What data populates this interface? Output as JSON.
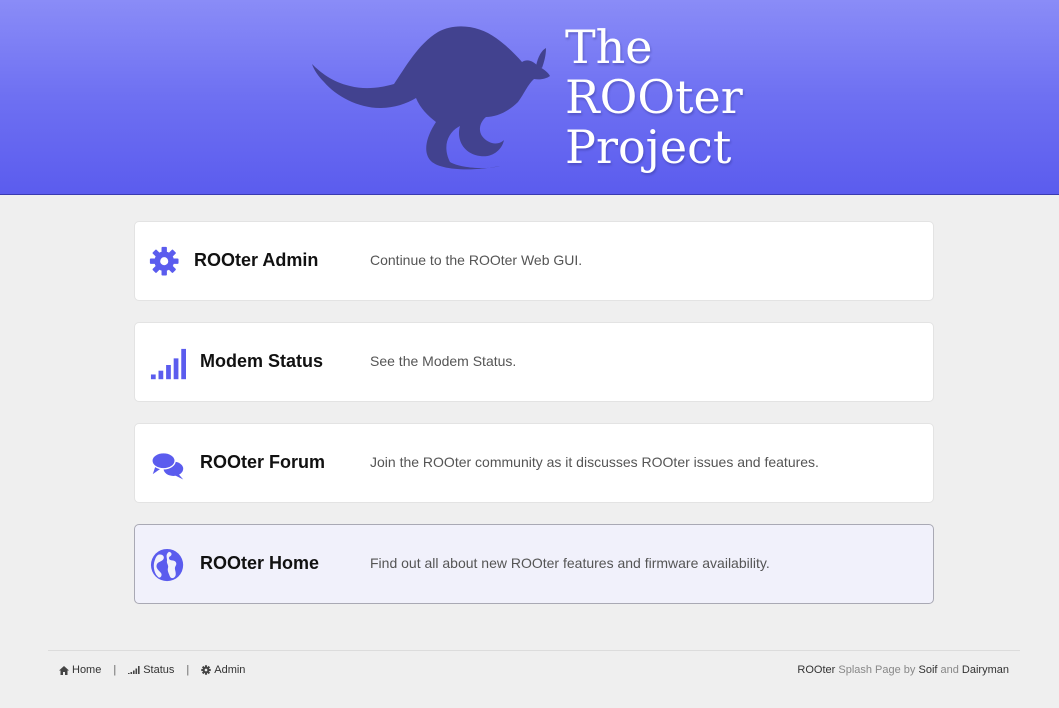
{
  "header": {
    "logo_line1": "The",
    "logo_line2": "ROOter",
    "logo_line3": "Project"
  },
  "cards": [
    {
      "title": "ROOter Admin",
      "description": "Continue to the ROOter Web GUI.",
      "icon": "gear-icon"
    },
    {
      "title": "Modem Status",
      "description": "See the Modem Status.",
      "icon": "signal-bars-icon"
    },
    {
      "title": "ROOter Forum",
      "description": "Join the ROOter community as it discusses ROOter issues and features.",
      "icon": "chat-bubbles-icon"
    },
    {
      "title": "ROOter Home",
      "description": "Find out all about new ROOter features and firmware availability.",
      "icon": "globe-icon"
    }
  ],
  "footer": {
    "links": [
      {
        "label": "Home",
        "icon": "home-icon"
      },
      {
        "label": "Status",
        "icon": "signal-bars-icon"
      },
      {
        "label": "Admin",
        "icon": "gear-icon"
      }
    ],
    "separator": "|",
    "credit_1": "ROOter",
    "credit_2": " Splash Page by ",
    "credit_3": "Soif",
    "credit_4": " and ",
    "credit_5": "Dairyman"
  },
  "colors": {
    "accent": "#5b5cee",
    "header_top": "#8a8cf7",
    "kangaroo": "#3f3f8f",
    "active_card_bg": "#f1f1fb"
  }
}
